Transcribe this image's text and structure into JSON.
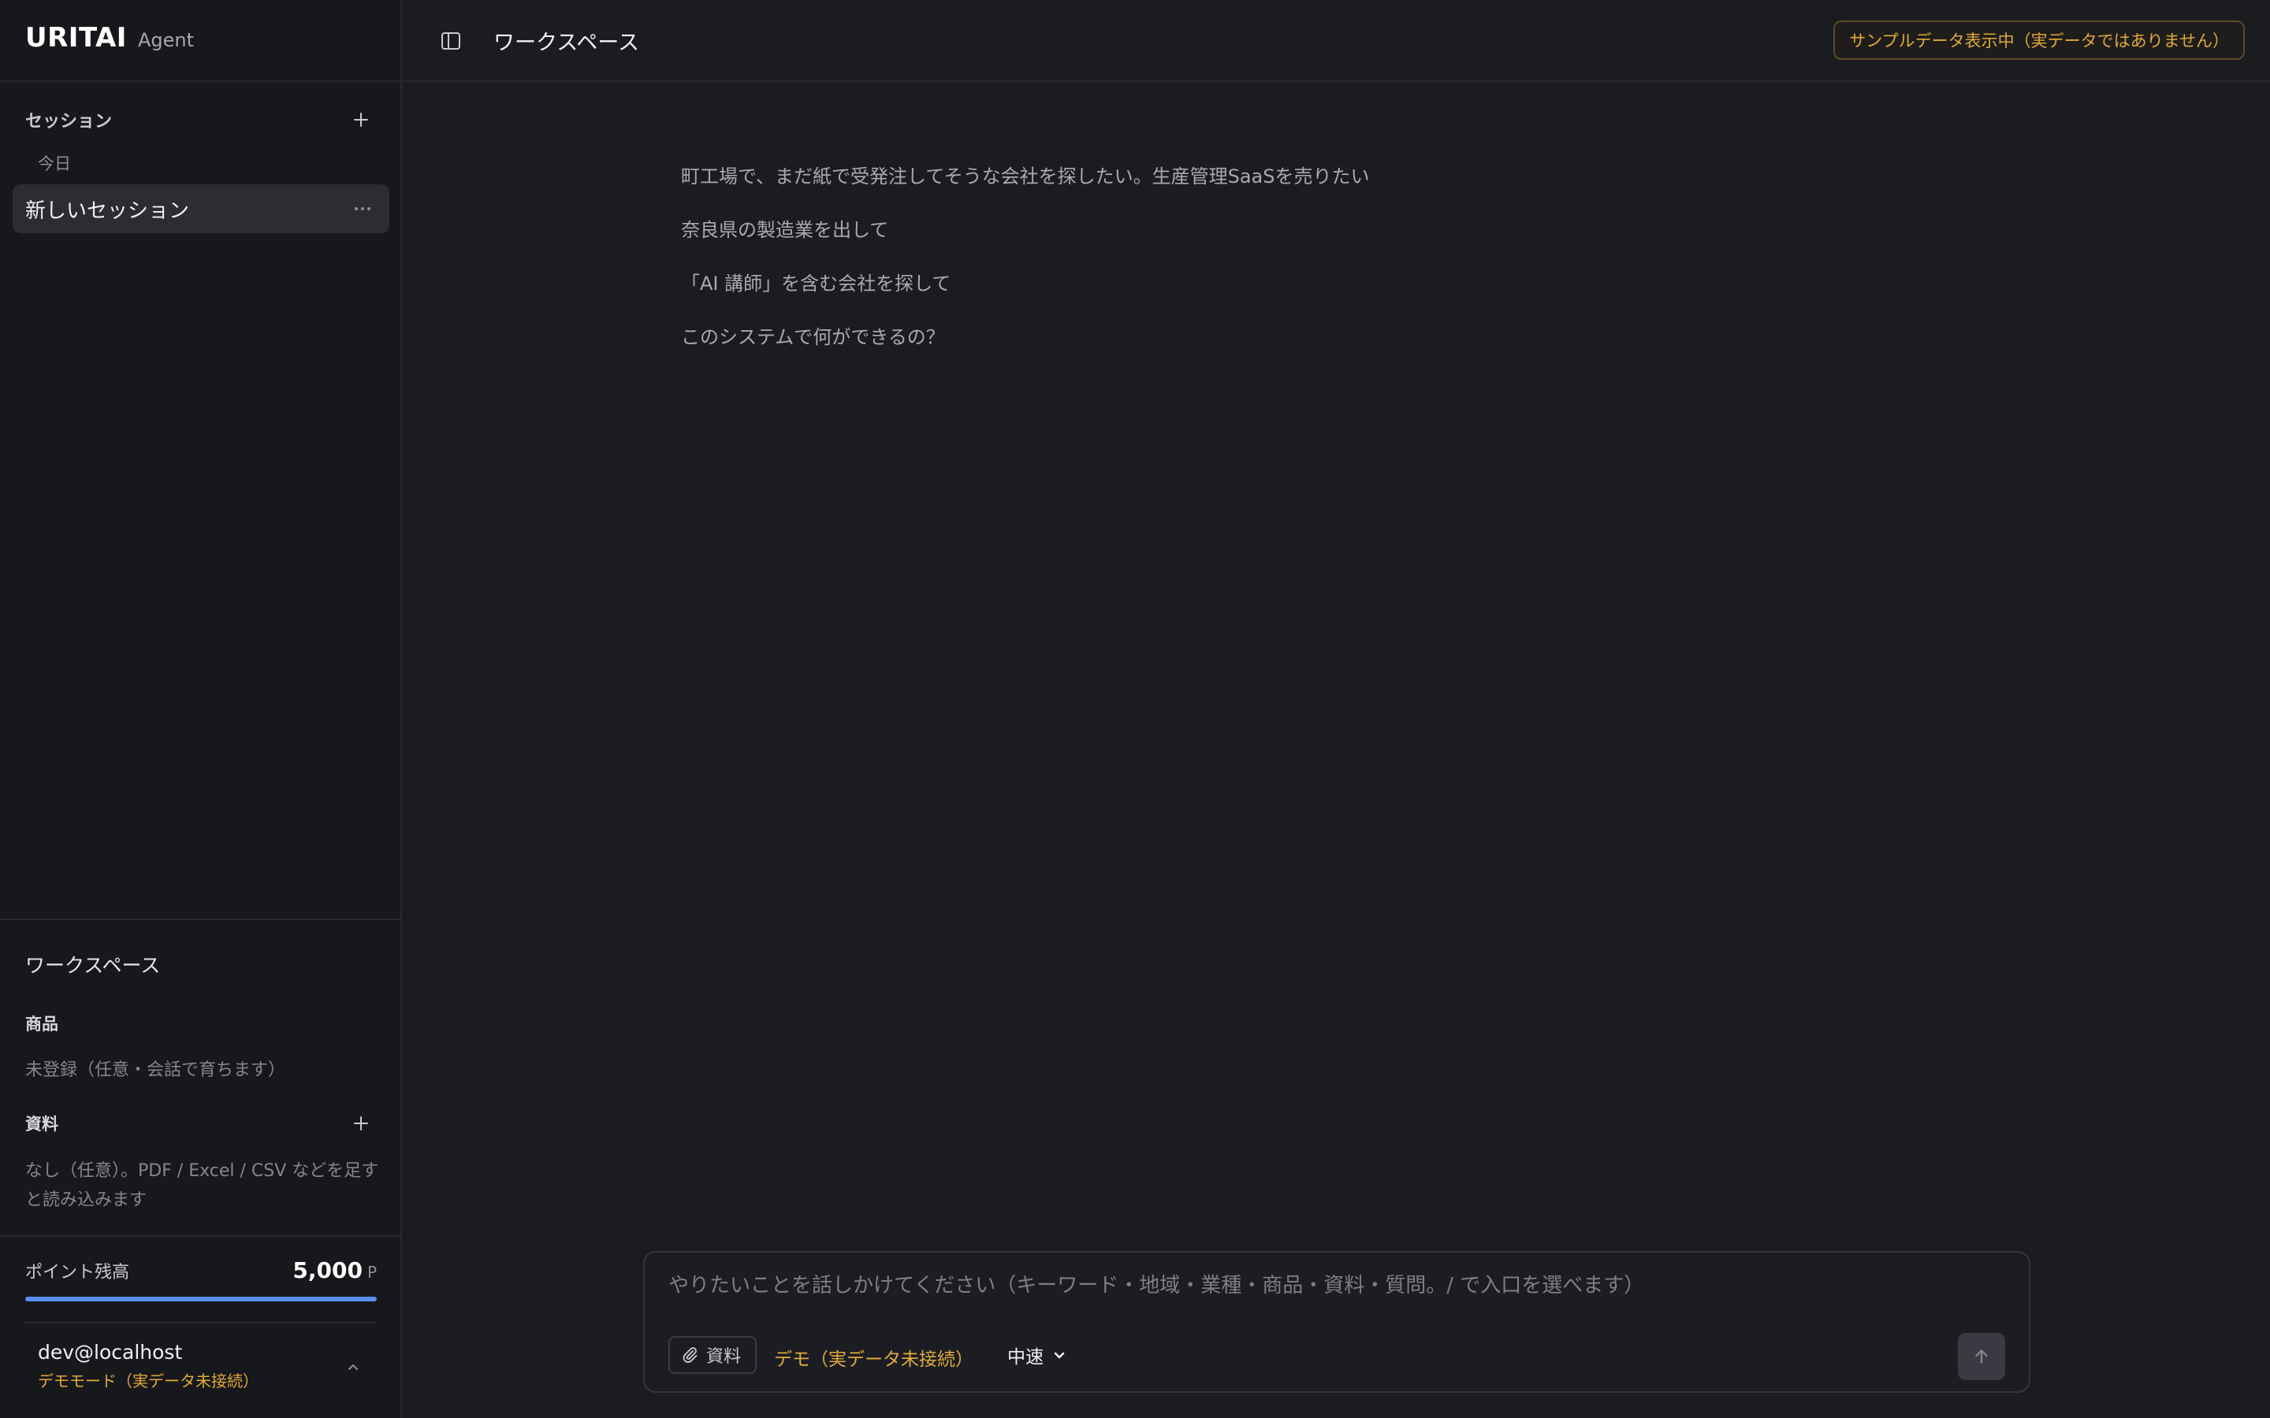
{
  "sidebar": {
    "brand": {
      "name": "URITAI",
      "sub": "Agent"
    },
    "sessions": {
      "title": "セッション",
      "group_today": "今日",
      "items": [
        {
          "label": "新しいセッション"
        }
      ]
    },
    "workspace": {
      "title": "ワークスペース",
      "product_title": "商品",
      "product_value": "未登録（任意・会話で育ちます）",
      "materials_title": "資料",
      "materials_desc": "なし（任意）。PDF / Excel / CSV などを足すと読み込みます"
    },
    "points": {
      "label": "ポイント残高",
      "value": "5,000",
      "unit": "P",
      "fill_fraction": 1.0
    },
    "user": {
      "email": "dev@localhost",
      "mode": "デモモード（実データ未接続）"
    }
  },
  "topbar": {
    "title": "ワークスペース",
    "sample_badge": "サンプルデータ表示中（実データではありません）"
  },
  "suggestions": [
    "町工場で、まだ紙で受発注してそうな会社を探したい。生産管理SaaSを売りたい",
    "奈良県の製造業を出して",
    "「AI 講師」を含む会社を探して",
    "このシステムで何ができるの？"
  ],
  "composer": {
    "placeholder": "やりたいことを話しかけてください（キーワード・地域・業種・商品・資料・質問。/ で入口を選べます）",
    "attach_label": "資料",
    "demo_status": "デモ（実データ未接続）",
    "speed_label": "中速"
  },
  "colors": {
    "accent_warning": "#e0a93b",
    "points_bar": "#5b8def",
    "background": "#1b1c20",
    "sidebar": "#17181b"
  },
  "icons": [
    "plus-icon",
    "more-dots-icon",
    "chevron-up-icon",
    "sidebar-toggle-icon",
    "paperclip-icon",
    "chevron-down-icon",
    "arrow-up-icon"
  ]
}
